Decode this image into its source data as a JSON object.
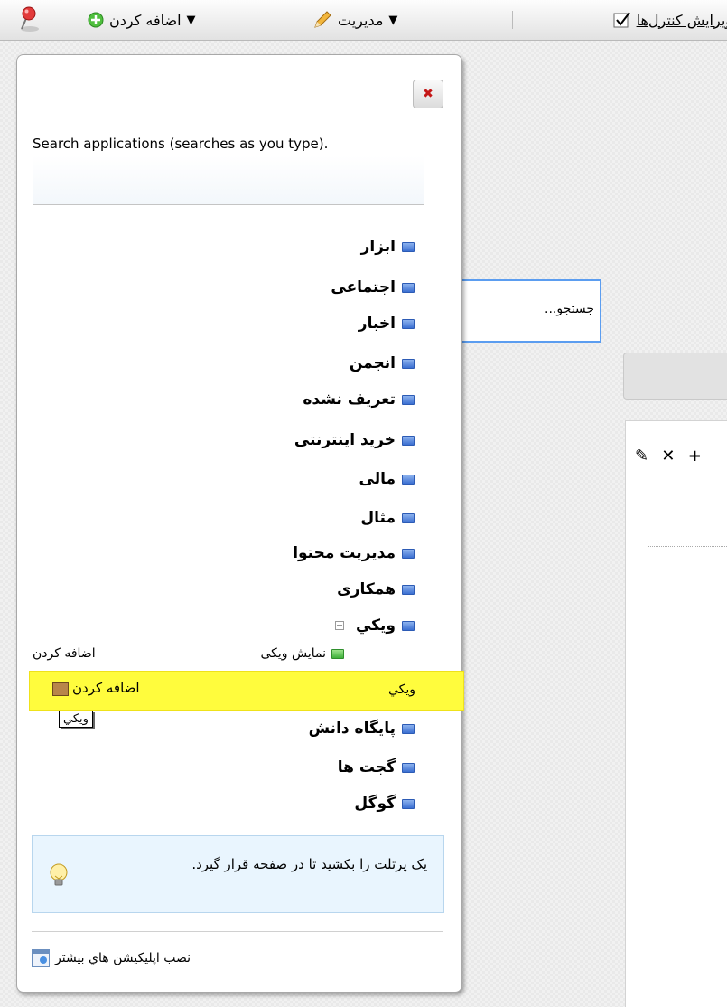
{
  "toolbar": {
    "edit_controls_label": "ویرایش کنترل‌ها",
    "manage_label": "مدیریت",
    "add_label": "اضافه کردن",
    "dropdown_arrow": "▼"
  },
  "background": {
    "search_placeholder": "جستجو...",
    "panel_icons": "✎ ✕ +"
  },
  "panel": {
    "close_symbol": "✖",
    "search_label": "Search applications (searches as you type).",
    "search_value": "",
    "categories": [
      {
        "label": "ابزار"
      },
      {
        "label": "اجتماعی"
      },
      {
        "label": "اخبار"
      },
      {
        "label": "انجمن"
      },
      {
        "label": "تعریف نشده"
      },
      {
        "label": "خرید اینترنتی"
      },
      {
        "label": "مالی"
      },
      {
        "label": "مثال"
      },
      {
        "label": "مدیریت محتوا"
      },
      {
        "label": "همکاری"
      },
      {
        "label": "ويکي",
        "expanded": true
      }
    ],
    "wiki_children": [
      {
        "label": "نمایش ویکی",
        "action": "اضافه کردن"
      },
      {
        "label": "ويکي",
        "action": "اضافه کردن",
        "highlighted": true,
        "tooltip": "ويکي"
      }
    ],
    "categories_after": [
      {
        "label": "پايگاه دانش"
      },
      {
        "label": "گجت ها"
      },
      {
        "label": "گوگل"
      }
    ],
    "hint_text": "یک پرتلت را بکشید تا در صفحه قرار گیرد.",
    "install_more_label": "نصب اپليکيشن هاي بيشتر"
  },
  "colors": {
    "highlight": "#fffc3d",
    "search_border": "#5b9df0",
    "hint_bg": "#e9f5fe",
    "close_x": "#c41616"
  }
}
